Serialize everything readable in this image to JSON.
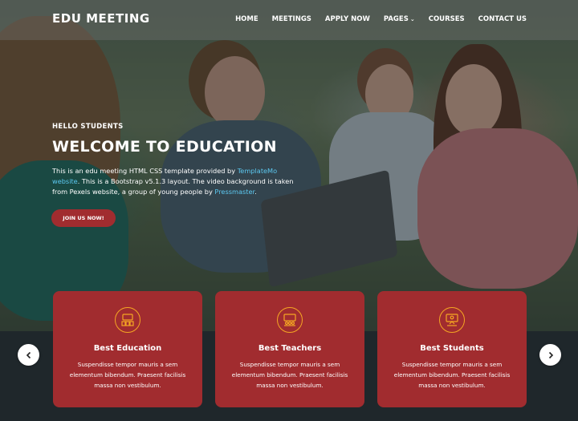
{
  "brand": {
    "logo": "EDU MEETING"
  },
  "nav": {
    "items": [
      {
        "label": "HOME"
      },
      {
        "label": "MEETINGS"
      },
      {
        "label": "APPLY NOW"
      },
      {
        "label": "PAGES",
        "has_dropdown": true
      },
      {
        "label": "COURSES"
      },
      {
        "label": "CONTACT US"
      }
    ]
  },
  "hero": {
    "kicker": "HELLO STUDENTS",
    "title": "WELCOME TO EDUCATION",
    "desc_1": "This is an edu meeting HTML CSS template provided by ",
    "desc_link_1": "TemplateMo website",
    "desc_2": ". This is a Bootstrap v5.1.3 layout. The video background is taken from Pexels website, a group of young people by ",
    "desc_link_2": "Pressmaster",
    "desc_3": ".",
    "cta_label": "JOIN US NOW!"
  },
  "services": [
    {
      "icon": "education-icon",
      "title": "Best Education",
      "text": "Suspendisse tempor mauris a sem elementum bibendum. Praesent facilisis massa non vestibulum."
    },
    {
      "icon": "teachers-icon",
      "title": "Best Teachers",
      "text": "Suspendisse tempor mauris a sem elementum bibendum. Praesent facilisis massa non vestibulum."
    },
    {
      "icon": "students-icon",
      "title": "Best Students",
      "text": "Suspendisse tempor mauris a sem elementum bibendum. Praesent facilisis massa non vestibulum."
    }
  ],
  "carousel": {
    "prev_icon": "chevron-left-icon",
    "next_icon": "chevron-right-icon"
  },
  "colors": {
    "accent": "#a12c2f",
    "icon_ring": "#f5a623",
    "link": "#5cc8f0",
    "dark": "#1f272b"
  }
}
